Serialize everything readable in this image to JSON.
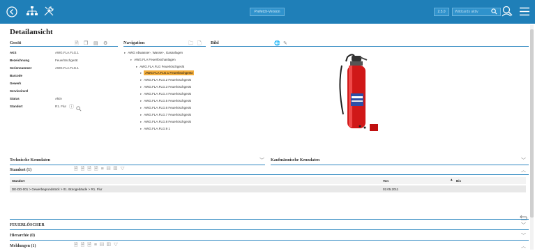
{
  "topbar": {
    "back": "back-icon",
    "tree": "hierarchy-icon",
    "tools": "tools-icon",
    "pill1": "Prefetch-Version",
    "pill2": "2.5.0",
    "search_placeholder": "Wildcards aktiv",
    "search_icon": "search-icon",
    "user_search": "user-search-icon",
    "menu": "menu-icon"
  },
  "page": {
    "title": "Detailansicht"
  },
  "geraet": {
    "title": "Gerät",
    "fields": [
      {
        "k": "AKS",
        "v": "AWG.FLA.FLG.1"
      },
      {
        "k": "Bezeichnung",
        "v": "Feuerlöschgerät"
      },
      {
        "k": "Seriennummer",
        "v": "AWG.FLA.FLG.1"
      },
      {
        "k": "Barcode",
        "v": ""
      },
      {
        "k": "Gewerk",
        "v": ""
      },
      {
        "k": "Serviceinvel",
        "v": ""
      },
      {
        "k": "Status",
        "v": "Aktiv"
      },
      {
        "k": "Standort",
        "v": "R1. Flur"
      }
    ]
  },
  "navigation": {
    "title": "Navigation",
    "items": [
      "AWG Abwasser-, Wasser-, Gasanlagen",
      "AWG.FLA Feuerlöschanlagen",
      "AWG.FLA.FLG Feuerlöschgerät",
      "AWG.FLA.FLG.1 Feuerlöschgerät",
      "AWG.FLA.FLG.2 Feuerlöschgerät",
      "AWG.FLA.FLG.3 Feuerlöschgerät",
      "AWG.FLA.FLG.4 Feuerlöschgerät",
      "AWG.FLA.FLG.5 Feuerlöschgerät",
      "AWG.FLA.FLG.6 Feuerlöschgerät",
      "AWG.FLA.FLG.7 Feuerlöschgerät",
      "AWG.FLA.FLG.8 Feuerlöschgerät",
      "AWG.FLA.FLG.9 1"
    ]
  },
  "bild": {
    "title": "Bild"
  },
  "sections": {
    "technische": "Technische Kenndaten",
    "kaufmaennische": "Kaufmännische Kenndaten",
    "standort": "Standort (1)",
    "feuerloescher": "FEUERLÖSCHER",
    "hierarchie": "Hierarchie (0)",
    "meldungen": "Meldungen (1)"
  },
  "table": {
    "headers": [
      "Standort",
      "Von",
      "Bis"
    ],
    "row": {
      "standort": "DE-DD-001 > Gewerbegrundstück > 01. Bürogebäude > R1. Flur",
      "von": "02.05.2011",
      "bis": ""
    }
  },
  "colors": {
    "topbar": "#1f7fb8",
    "accent": "#2b86c0",
    "selection": "#f3ae3d"
  }
}
